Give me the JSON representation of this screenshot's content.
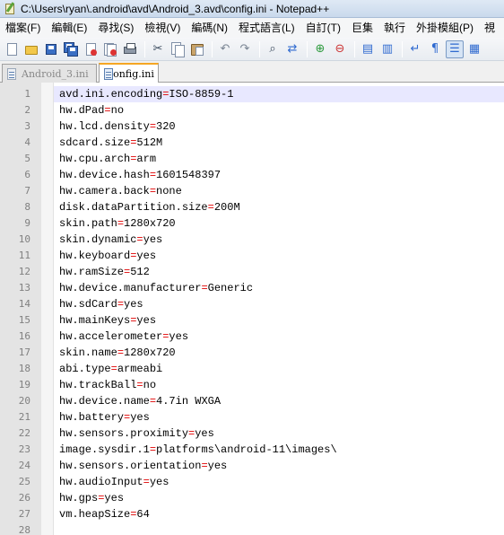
{
  "window": {
    "title": "C:\\Users\\ryan\\.android\\avd\\Android_3.avd\\config.ini - Notepad++",
    "icon": "notepad-plus-plus-icon"
  },
  "menu": [
    "檔案(F)",
    "編輯(E)",
    "尋找(S)",
    "檢視(V)",
    "編碼(N)",
    "程式語言(L)",
    "自訂(T)",
    "巨集",
    "執行",
    "外掛模組(P)",
    "視"
  ],
  "toolbar": {
    "icons": [
      "new-file-icon",
      "open-file-icon",
      "save-icon",
      "save-all-icon",
      "close-icon",
      "close-all-icon",
      "print-icon",
      "cut-icon",
      "copy-icon",
      "paste-icon",
      "undo-icon",
      "redo-icon",
      "find-icon",
      "replace-icon",
      "zoom-in-icon",
      "zoom-out-icon",
      "sync-vertical-icon",
      "sync-horizontal-icon",
      "word-wrap-icon",
      "show-all-chars-icon",
      "indent-guide-icon",
      "doc-map-icon"
    ]
  },
  "tabs": [
    {
      "label": "Android_3.ini",
      "active": false
    },
    {
      "label": "config.ini",
      "active": true
    }
  ],
  "editor": {
    "current_line": 1,
    "lines": [
      {
        "n": "1",
        "key": "avd.ini.encoding",
        "value": "ISO-8859-1"
      },
      {
        "n": "2",
        "key": "hw.dPad",
        "value": "no"
      },
      {
        "n": "3",
        "key": "hw.lcd.density",
        "value": "320"
      },
      {
        "n": "4",
        "key": "sdcard.size",
        "value": "512M"
      },
      {
        "n": "5",
        "key": "hw.cpu.arch",
        "value": "arm"
      },
      {
        "n": "6",
        "key": "hw.device.hash",
        "value": "1601548397"
      },
      {
        "n": "7",
        "key": "hw.camera.back",
        "value": "none"
      },
      {
        "n": "8",
        "key": "disk.dataPartition.size",
        "value": "200M"
      },
      {
        "n": "9",
        "key": "skin.path",
        "value": "1280x720"
      },
      {
        "n": "10",
        "key": "skin.dynamic",
        "value": "yes"
      },
      {
        "n": "11",
        "key": "hw.keyboard",
        "value": "yes"
      },
      {
        "n": "12",
        "key": "hw.ramSize",
        "value": "512"
      },
      {
        "n": "13",
        "key": "hw.device.manufacturer",
        "value": "Generic"
      },
      {
        "n": "14",
        "key": "hw.sdCard",
        "value": "yes"
      },
      {
        "n": "15",
        "key": "hw.mainKeys",
        "value": "yes"
      },
      {
        "n": "16",
        "key": "hw.accelerometer",
        "value": "yes"
      },
      {
        "n": "17",
        "key": "skin.name",
        "value": "1280x720"
      },
      {
        "n": "18",
        "key": "abi.type",
        "value": "armeabi"
      },
      {
        "n": "19",
        "key": "hw.trackBall",
        "value": "no"
      },
      {
        "n": "20",
        "key": "hw.device.name",
        "value": "4.7in WXGA"
      },
      {
        "n": "21",
        "key": "hw.battery",
        "value": "yes"
      },
      {
        "n": "22",
        "key": "hw.sensors.proximity",
        "value": "yes"
      },
      {
        "n": "23",
        "key": "image.sysdir.1",
        "value": "platforms\\android-11\\images\\"
      },
      {
        "n": "24",
        "key": "hw.sensors.orientation",
        "value": "yes"
      },
      {
        "n": "25",
        "key": "hw.audioInput",
        "value": "yes"
      },
      {
        "n": "26",
        "key": "hw.gps",
        "value": "yes"
      },
      {
        "n": "27",
        "key": "vm.heapSize",
        "value": "64"
      },
      {
        "n": "28",
        "key": "",
        "value": ""
      }
    ]
  },
  "colors": {
    "operator": "#e00000",
    "current_line_bg": "#e8e8ff",
    "gutter_bg": "#e4e4e4",
    "active_tab_accent": "#f5a623"
  }
}
